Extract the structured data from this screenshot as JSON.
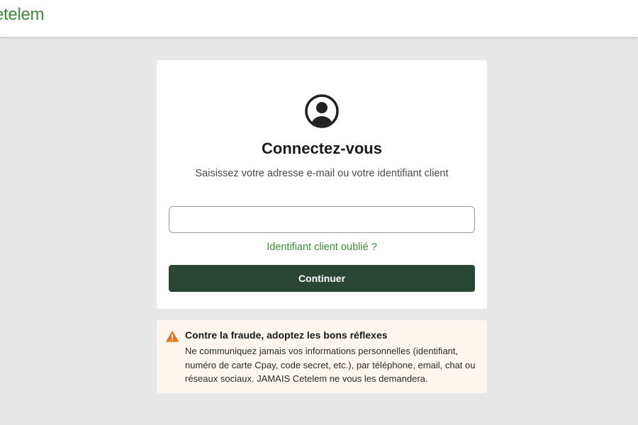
{
  "header": {
    "logo_text": "etelem",
    "brand_color": "#3f8a3a"
  },
  "login": {
    "avatar_icon": "user-circle-icon",
    "title": "Connectez-vous",
    "subtitle": "Saisissez votre adresse e-mail ou votre identifiant client",
    "identifier_value": "",
    "identifier_placeholder": "",
    "forgot_link": "Identifiant client oublié ?",
    "continue_label": "Continuer",
    "button_color": "#2a4736"
  },
  "fraud_alert": {
    "icon": "warning-icon",
    "icon_color": "#e07b24",
    "title": "Contre la fraude, adoptez les bons réflexes",
    "lines": [
      "Ne communiquez jamais vos informations personnelles (identifiant,",
      "numéro de carte Cpay, code secret, etc.), par téléphone, email, chat ou",
      "réseaux sociaux. JAMAIS Cetelem ne vous les demandera."
    ],
    "background": "#fdf6ee"
  }
}
